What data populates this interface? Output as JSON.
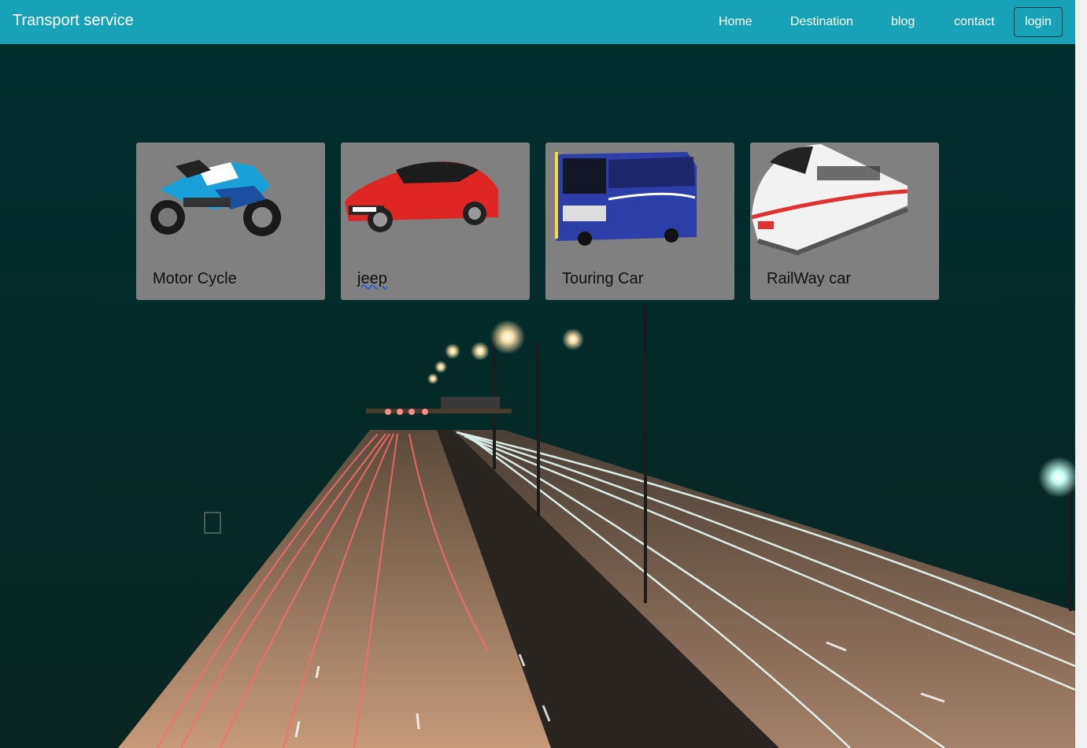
{
  "navbar": {
    "brand": "Transport service",
    "links": [
      "Home",
      "Destination",
      "blog",
      "contact"
    ],
    "login": "login",
    "bg_color": "#17a2b8"
  },
  "cards": [
    {
      "title": "Motor Cycle",
      "icon": "motorcycle-image"
    },
    {
      "title": "jeep",
      "icon": "sports-car-image"
    },
    {
      "title": "Touring Car",
      "icon": "bus-image"
    },
    {
      "title": "RailWay car",
      "icon": "train-image"
    }
  ],
  "colors": {
    "page_bg": "#01302f",
    "card_bg": "#808080"
  }
}
